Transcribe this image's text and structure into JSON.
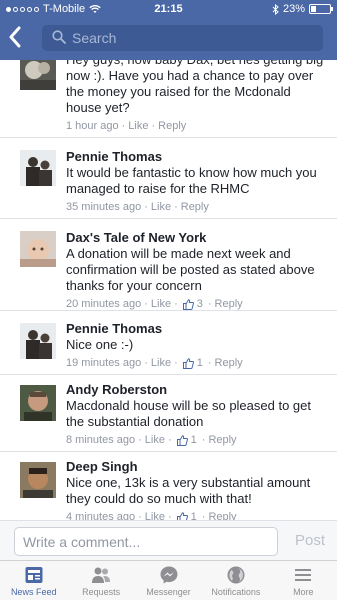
{
  "status_bar": {
    "carrier": "T-Mobile",
    "time": "21:15",
    "battery": "23%",
    "battery_level": 0.23
  },
  "header": {
    "search_placeholder": "Search",
    "icons": [
      "back-icon",
      "search-icon"
    ]
  },
  "comments": [
    {
      "name": "",
      "text": "Hey guys, how baby Dax, bet hes getting big now :). Have you had a chance to pay over the money you raised for the Mcdonald house yet?",
      "time": "1 hour ago",
      "like": "Like",
      "reply": "Reply",
      "likes": ""
    },
    {
      "name": "Pennie Thomas",
      "text": "It would be fantastic to know how much you managed to raise for the RHMC",
      "time": "35 minutes ago",
      "like": "Like",
      "reply": "Reply",
      "likes": ""
    },
    {
      "name": "Dax's Tale of New York",
      "text": "A donation will be made next week and confirmation will be posted as stated above thanks for your concern",
      "time": "20 minutes ago",
      "like": "Like",
      "reply": "Reply",
      "likes": "3"
    },
    {
      "name": "Pennie Thomas",
      "text": "Nice one  :-)",
      "time": "19 minutes ago",
      "like": "Like",
      "reply": "Reply",
      "likes": "1"
    },
    {
      "name": "Andy Roberston",
      "text": "Macdonald house will be so pleased to get the substantial donation",
      "time": "8 minutes ago",
      "like": "Like",
      "reply": "Reply",
      "likes": "1"
    },
    {
      "name": "Deep Singh",
      "text": "Nice one,  13k is a very substantial amount they could do so much with that!",
      "time": "4 minutes ago",
      "like": "Like",
      "reply": "Reply",
      "likes": "1"
    }
  ],
  "composer": {
    "placeholder": "Write a comment...",
    "post_label": "Post"
  },
  "tabs": [
    {
      "label": "News Feed",
      "icon": "news-feed-icon",
      "active": true
    },
    {
      "label": "Requests",
      "icon": "requests-icon",
      "active": false
    },
    {
      "label": "Messenger",
      "icon": "messenger-icon",
      "active": false
    },
    {
      "label": "Notifications",
      "icon": "globe-icon",
      "active": false
    },
    {
      "label": "More",
      "icon": "menu-icon",
      "active": false
    }
  ],
  "colors": {
    "brand": "#4b68a6",
    "meta_text": "#9197a3",
    "like_icon": "#4b68a6"
  }
}
